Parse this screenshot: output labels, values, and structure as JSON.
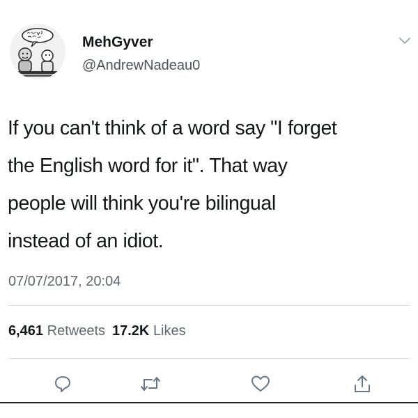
{
  "author": {
    "display_name": "MehGyver",
    "handle": "@AndrewNadeau0",
    "avatar_caption": "I own 7 pens!"
  },
  "tweet": {
    "text": "If you can't think of a word say \"I forget\nthe English word for it\". That way\npeople will think you're bilingual\ninstead of an idiot.",
    "timestamp": "07/07/2017, 20:04"
  },
  "stats": {
    "retweets_count": "6,461",
    "retweets_label": "Retweets",
    "likes_count": "17.2K",
    "likes_label": "Likes"
  },
  "actions": {
    "icons": [
      "reply-icon",
      "retweet-icon",
      "like-icon",
      "share-icon"
    ]
  },
  "colors": {
    "text_primary": "#14171a",
    "text_secondary": "#5f666d",
    "divider": "#dcdcdc"
  }
}
